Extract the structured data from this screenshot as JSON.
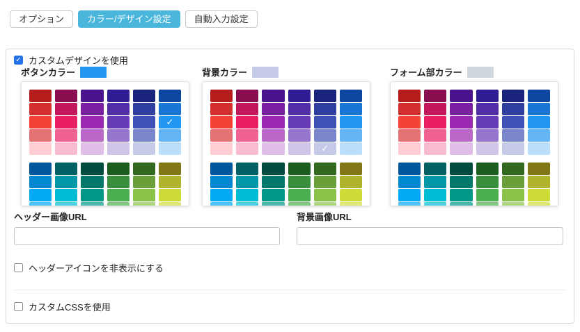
{
  "tabs": [
    {
      "label": "オプション",
      "active": false
    },
    {
      "label": "カラー/デザイン設定",
      "active": true
    },
    {
      "label": "自動入力設定",
      "active": false
    }
  ],
  "accent_colors": {
    "active_tab_bg": "#4bb6db",
    "checkbox_checked": "#2573e8"
  },
  "checkboxes": {
    "use_custom_design": {
      "label": "カスタムデザインを使用",
      "checked": true
    },
    "hide_header_icon": {
      "label": "ヘッダーアイコンを非表示にする",
      "checked": false
    },
    "use_custom_css": {
      "label": "カスタムCSSを使用",
      "checked": false
    }
  },
  "pickers": [
    {
      "label": "ボタンカラー",
      "selected_color": "#2196f3",
      "selection": {
        "block": 0,
        "row": 2,
        "col": 5
      }
    },
    {
      "label": "背景カラー",
      "selected_color": "#c5cae9",
      "selection": {
        "block": 0,
        "row": 4,
        "col": 4
      }
    },
    {
      "label": "フォーム部カラー",
      "selected_color": "#cfd8dc",
      "selection": null
    }
  ],
  "palette": {
    "block1": [
      [
        "#b71c1c",
        "#880e4f",
        "#4a148c",
        "#311b92",
        "#1a237e",
        "#0d47a1"
      ],
      [
        "#d32f2f",
        "#c2185b",
        "#7b1fa2",
        "#512da8",
        "#303f9f",
        "#1976d2"
      ],
      [
        "#f44336",
        "#e91e63",
        "#9c27b0",
        "#673ab7",
        "#3f51b5",
        "#2196f3"
      ],
      [
        "#e57373",
        "#f06292",
        "#ba68c8",
        "#9575cd",
        "#7986cb",
        "#64b5f6"
      ],
      [
        "#ffcdd2",
        "#f8bbd0",
        "#e1bee7",
        "#d1c4e9",
        "#c5cae9",
        "#bbdefb"
      ]
    ],
    "block2": [
      [
        "#01579b",
        "#006064",
        "#004d40",
        "#1b5e20",
        "#33691e",
        "#827717"
      ],
      [
        "#0288d1",
        "#0097a7",
        "#00796b",
        "#388e3c",
        "#689f38",
        "#afb42b"
      ],
      [
        "#03a9f4",
        "#00bcd4",
        "#009688",
        "#4caf50",
        "#8bc34a",
        "#cddc39"
      ],
      [
        "#4fc3f7",
        "#4dd0e1",
        "#4db6ac",
        "#81c784",
        "#aed581",
        "#dce775"
      ],
      [
        "#b3e5fc",
        "#b2ebf2",
        "#b2dfdb",
        "#c8e6c9",
        "#dcedc8",
        "#f0f4c3"
      ]
    ]
  },
  "inputs": [
    {
      "label": "ヘッダー画像URL",
      "value": "",
      "placeholder": ""
    },
    {
      "label": "背景画像URL",
      "value": "",
      "placeholder": ""
    }
  ],
  "check_glyph": "✓"
}
